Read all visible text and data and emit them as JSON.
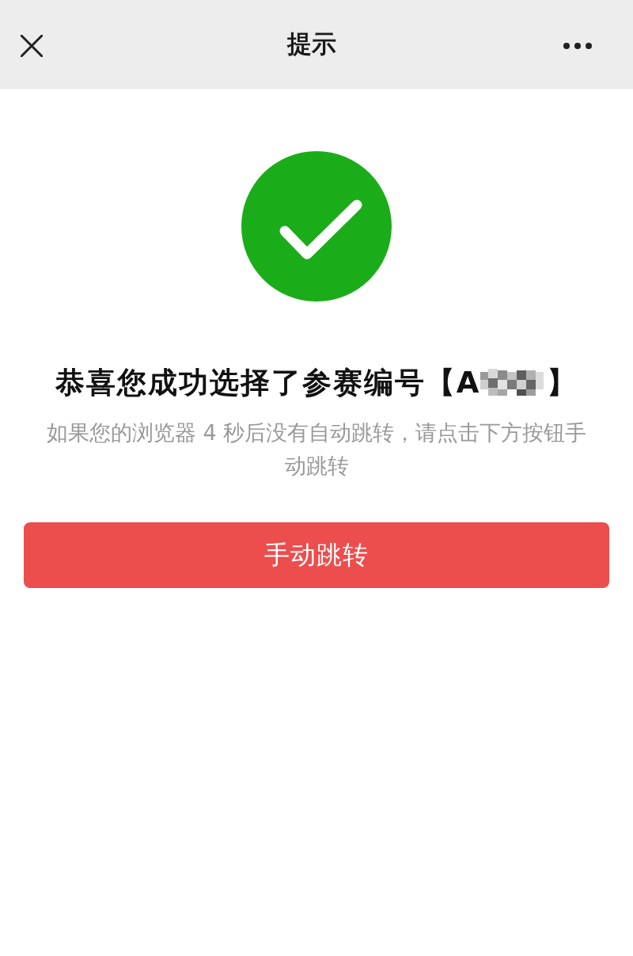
{
  "nav_bar": {
    "title": "提示"
  },
  "result": {
    "kind": "success",
    "heading": {
      "text": "恭喜您成功选择了参赛编号【A",
      "redacted": true,
      "closing": "】"
    },
    "message": "如果您的浏览器 4 秒后没有自动跳转，请点击下方按钮手动跳转"
  },
  "buttons": [
    {
      "label": "手动跳转",
      "kind": "primary"
    }
  ]
}
